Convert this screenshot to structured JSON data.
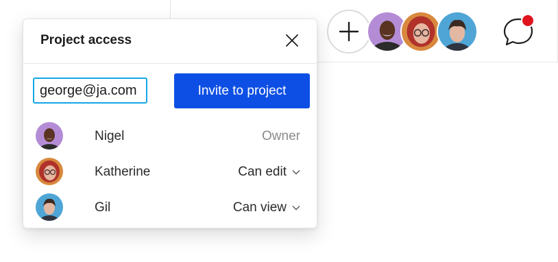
{
  "dialog": {
    "title": "Project access",
    "email_value": "george@ja.com",
    "invite_label": "Invite to project",
    "members": [
      {
        "name": "Nigel",
        "role": "Owner",
        "editable": false,
        "avatar_color": "#b48cd6"
      },
      {
        "name": "Katherine",
        "role": "Can edit",
        "editable": true,
        "avatar_color": "#d8893e"
      },
      {
        "name": "Gil",
        "role": "Can view",
        "editable": true,
        "avatar_color": "#4fa5d6"
      }
    ]
  },
  "topbar": {
    "collaborators": [
      {
        "avatar_color": "#b48cd6"
      },
      {
        "avatar_color": "#d8893e"
      },
      {
        "avatar_color": "#4fa5d6"
      }
    ],
    "notification_color": "#e0141e"
  },
  "colors": {
    "accent": "#0d4fe4",
    "focus": "#13a6e6"
  },
  "icons": [
    "plus-icon",
    "chat-icon",
    "close-icon",
    "chevron-down-icon"
  ]
}
